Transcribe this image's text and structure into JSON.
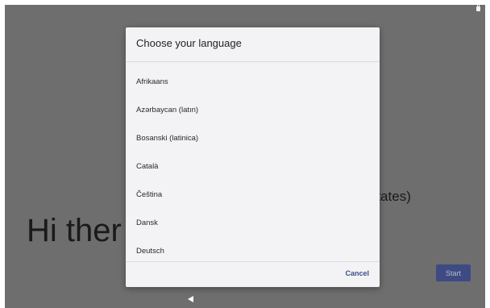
{
  "background": {
    "greeting": "Hi ther",
    "language_fragment": "States)",
    "start_label": "Start"
  },
  "dialog": {
    "title": "Choose your language",
    "items": [
      {
        "label": "Afrikaans"
      },
      {
        "label": "Azərbaycan (latın)"
      },
      {
        "label": "Bosanski (latinica)"
      },
      {
        "label": "Català"
      },
      {
        "label": "Čeština"
      },
      {
        "label": "Dansk"
      },
      {
        "label": "Deutsch"
      }
    ],
    "cancel_label": "Cancel"
  },
  "colors": {
    "scrim": "#6e6e6e",
    "dialog_bg": "#f3f3f5",
    "accent": "#3d4f8a",
    "start_button": "#3e4a84"
  },
  "icons": {
    "status": "lock-icon",
    "nav": "back-icon"
  }
}
